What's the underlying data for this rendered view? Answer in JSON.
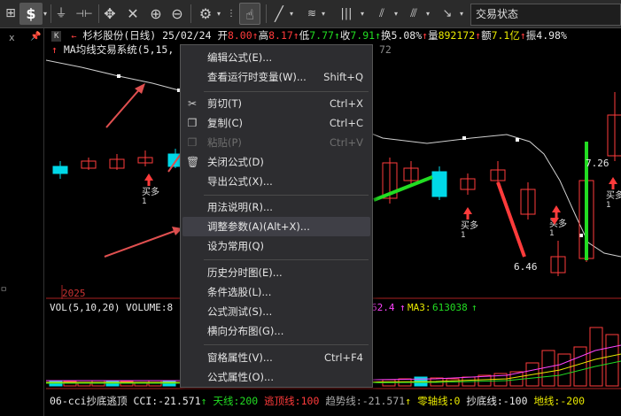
{
  "toolbar": {
    "dollar_label": "$",
    "right_state": "交易状态"
  },
  "left_panel": {
    "close_glyph": "x",
    "pin_glyph": "ㅁ"
  },
  "header": {
    "k_label": "K",
    "stock_name": "杉杉股份(日线)",
    "date": "25/02/24",
    "open_label": "开",
    "open": "8.00",
    "high_label": "高",
    "high": "8.17",
    "low_label": "低",
    "low": "7.77",
    "close_label": "收",
    "close": "7.91",
    "turnover_label": "换",
    "turnover": "5.08%",
    "volume_label": "量",
    "volume": "892172",
    "amount_label": "额",
    "amount": "7.1亿",
    "amplitude_label": "振",
    "amplitude": "4.98%"
  },
  "indicator_main": {
    "label": "MA均线交易系统(5,15,",
    "tail": "72"
  },
  "chart_labels": {
    "year": "2025",
    "low_price": "6.46",
    "price_726": "7.26",
    "buy_tag": "买多",
    "one": "1"
  },
  "volume_header": {
    "label": "VOL(5,10,20) VOLUME:8",
    "ma2_value": "62.4",
    "ma3_label": "MA3:",
    "ma3_value": "613038"
  },
  "cci_bar": {
    "name": "06-cci抄底逃顶",
    "cci": "CCI:-21.571",
    "tianxian": "天线:200",
    "taoding": "逃顶线:100",
    "qushi": "趋势线:-21.571",
    "linzhou": "零轴线:0",
    "chaodi": "抄底线:-100",
    "dixian": "地线:-200"
  },
  "context_menu": {
    "items": [
      {
        "label": "编辑公式(E)...",
        "shortcut": ""
      },
      {
        "label": "查看运行时变量(W)...",
        "shortcut": "Shift+Q"
      },
      {
        "label": "剪切(T)",
        "shortcut": "Ctrl+X"
      },
      {
        "label": "复制(C)",
        "shortcut": "Ctrl+C"
      },
      {
        "label": "粘贴(P)",
        "shortcut": "Ctrl+V"
      },
      {
        "label": "关闭公式(D)",
        "shortcut": ""
      },
      {
        "label": "导出公式(X)...",
        "shortcut": ""
      },
      {
        "label": "用法说明(R)...",
        "shortcut": ""
      },
      {
        "label": "调整参数(A)(Alt+X)...",
        "shortcut": ""
      },
      {
        "label": "设为常用(Q)",
        "shortcut": ""
      },
      {
        "label": "历史分时图(E)...",
        "shortcut": ""
      },
      {
        "label": "条件选股(L)...",
        "shortcut": ""
      },
      {
        "label": "公式测试(S)...",
        "shortcut": ""
      },
      {
        "label": "横向分布图(G)...",
        "shortcut": ""
      },
      {
        "label": "窗格属性(V)...",
        "shortcut": "Ctrl+F4"
      },
      {
        "label": "公式属性(O)...",
        "shortcut": ""
      }
    ]
  },
  "colors": {
    "up": "#ff3b3b",
    "down": "#00d8e8",
    "green": "#22dd22",
    "yellow": "#e8e800",
    "magenta": "#ff44ff",
    "arrow": "#e05050"
  }
}
